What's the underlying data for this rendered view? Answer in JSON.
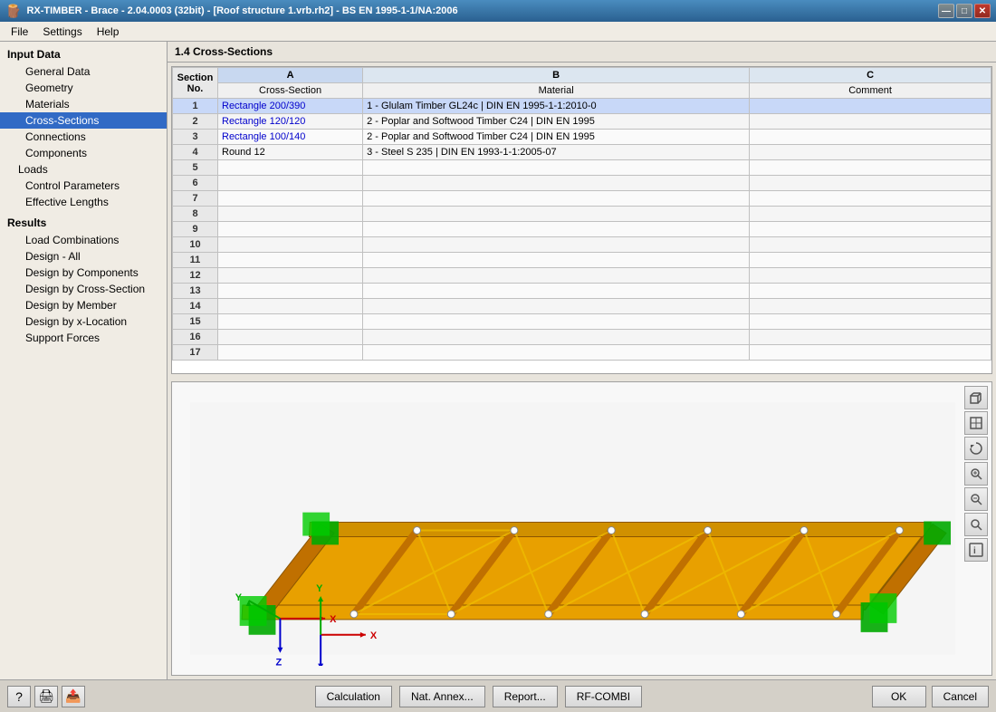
{
  "titleBar": {
    "title": "RX-TIMBER - Brace - 2.04.0003 (32bit) - [Roof structure 1.vrb.rh2] - BS EN 1995-1-1/NA:2006",
    "minBtn": "—",
    "maxBtn": "□",
    "closeBtn": "✕"
  },
  "menuBar": {
    "items": [
      "File",
      "Settings",
      "Help"
    ]
  },
  "sidebar": {
    "inputDataHeader": "Input Data",
    "items": [
      {
        "label": "General Data",
        "indent": "sub",
        "active": false
      },
      {
        "label": "Geometry",
        "indent": "sub",
        "active": false
      },
      {
        "label": "Materials",
        "indent": "sub",
        "active": false
      },
      {
        "label": "Cross-Sections",
        "indent": "sub",
        "active": true
      },
      {
        "label": "Connections",
        "indent": "sub",
        "active": false
      },
      {
        "label": "Components",
        "indent": "sub",
        "active": false
      },
      {
        "label": "Loads",
        "indent": "top",
        "active": false
      },
      {
        "label": "Control Parameters",
        "indent": "sub",
        "active": false
      },
      {
        "label": "Effective Lengths",
        "indent": "sub",
        "active": false
      }
    ],
    "resultsHeader": "Results",
    "resultItems": [
      {
        "label": "Load Combinations",
        "indent": "sub",
        "active": false
      },
      {
        "label": "Design - All",
        "indent": "sub",
        "active": false
      },
      {
        "label": "Design by Components",
        "indent": "sub",
        "active": false
      },
      {
        "label": "Design by Cross-Section",
        "indent": "sub",
        "active": false
      },
      {
        "label": "Design by Member",
        "indent": "sub",
        "active": false
      },
      {
        "label": "Design by x-Location",
        "indent": "sub",
        "active": false
      },
      {
        "label": "Support Forces",
        "indent": "sub",
        "active": false
      }
    ]
  },
  "sectionTitle": "1.4 Cross-Sections",
  "table": {
    "colHeaders": [
      "A",
      "B",
      "C"
    ],
    "subHeaders": [
      "Cross-Section",
      "Material",
      "Comment"
    ],
    "rows": [
      {
        "no": "1",
        "crossSection": "Rectangle 200/390",
        "material": "1 - Glulam Timber GL24c | DIN EN 1995-1-1:2010-0",
        "comment": "",
        "selected": true
      },
      {
        "no": "2",
        "crossSection": "Rectangle 120/120",
        "material": "2 - Poplar and Softwood Timber C24 | DIN EN 1995",
        "comment": "",
        "selected": false
      },
      {
        "no": "3",
        "crossSection": "Rectangle 100/140",
        "material": "2 - Poplar and Softwood Timber C24 | DIN EN 1995",
        "comment": "",
        "selected": false,
        "highlight": true
      },
      {
        "no": "4",
        "crossSection": "Round 12",
        "material": "3 - Steel S 235 | DIN EN 1993-1-1:2005-07",
        "comment": "",
        "selected": false
      },
      {
        "no": "5",
        "crossSection": "",
        "material": "",
        "comment": ""
      },
      {
        "no": "6",
        "crossSection": "",
        "material": "",
        "comment": ""
      },
      {
        "no": "7",
        "crossSection": "",
        "material": "",
        "comment": ""
      },
      {
        "no": "8",
        "crossSection": "",
        "material": "",
        "comment": ""
      },
      {
        "no": "9",
        "crossSection": "",
        "material": "",
        "comment": ""
      },
      {
        "no": "10",
        "crossSection": "",
        "material": "",
        "comment": ""
      },
      {
        "no": "11",
        "crossSection": "",
        "material": "",
        "comment": ""
      },
      {
        "no": "12",
        "crossSection": "",
        "material": "",
        "comment": ""
      },
      {
        "no": "13",
        "crossSection": "",
        "material": "",
        "comment": ""
      },
      {
        "no": "14",
        "crossSection": "",
        "material": "",
        "comment": ""
      },
      {
        "no": "15",
        "crossSection": "",
        "material": "",
        "comment": ""
      },
      {
        "no": "16",
        "crossSection": "",
        "material": "",
        "comment": ""
      },
      {
        "no": "17",
        "crossSection": "",
        "material": "",
        "comment": ""
      }
    ]
  },
  "viewToolbar": {
    "buttons": [
      "view3d",
      "view2d",
      "rotate",
      "zoom-fit",
      "zoom-custom",
      "magnify",
      "info"
    ]
  },
  "footer": {
    "iconButtons": [
      "help",
      "print",
      "export"
    ],
    "centerButtons": [
      "Calculation",
      "Nat. Annex...",
      "Report...",
      "RF-COMBI"
    ],
    "rightButtons": [
      "OK",
      "Cancel"
    ]
  },
  "axes": {
    "x": "X",
    "y": "Y",
    "z": "Z"
  }
}
